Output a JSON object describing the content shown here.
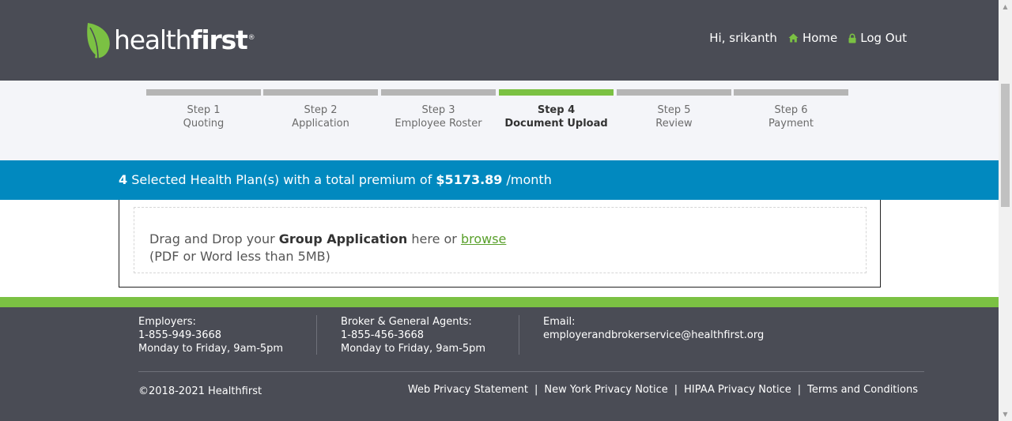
{
  "header": {
    "logo": {
      "text_regular": "health",
      "text_bold": "first",
      "registered": "®",
      "leaf_color": "#7bc143"
    },
    "greeting": "Hi, srikanth",
    "home_label": "Home",
    "logout_label": "Log Out",
    "icons": {
      "home": "home-icon",
      "logout": "lock-icon"
    }
  },
  "steps": [
    {
      "line1": "Step 1",
      "line2": "Quoting",
      "active": false
    },
    {
      "line1": "Step 2",
      "line2": "Application",
      "active": false
    },
    {
      "line1": "Step 3",
      "line2": "Employee Roster",
      "active": false
    },
    {
      "line1": "Step 4",
      "line2": "Document Upload",
      "active": true
    },
    {
      "line1": "Step 5",
      "line2": "Review",
      "active": false
    },
    {
      "line1": "Step 6",
      "line2": "Payment",
      "active": false
    }
  ],
  "banner": {
    "count": "4",
    "text_mid": " Selected Health Plan(s) with a total premium of ",
    "amount": "$5173.89",
    "suffix": " /month",
    "color": "#0189bf"
  },
  "upload": {
    "prefix": "Drag and Drop your ",
    "doc_name": "Group Application",
    "middle": " here or ",
    "browse_label": "browse",
    "hint": "(PDF or Word less than 5MB)"
  },
  "footer": {
    "employers": {
      "title": "Employers:",
      "phone": "1-855-949-3668",
      "hours": "Monday to Friday, 9am-5pm"
    },
    "brokers": {
      "title": "Broker & General Agents:",
      "phone": "1-855-456-3668",
      "hours": "Monday to Friday, 9am-5pm"
    },
    "email": {
      "title": "Email:",
      "address": "employerandbrokerservice@healthfirst.org"
    },
    "copyright": "©2018-2021 Healthfirst",
    "links": [
      "Web Privacy Statement",
      "New York Privacy Notice",
      "HIPAA Privacy Notice",
      "Terms and Conditions"
    ]
  },
  "colors": {
    "header_bg": "#4a4c55",
    "accent_green": "#7bc143",
    "banner_blue": "#0189bf"
  }
}
